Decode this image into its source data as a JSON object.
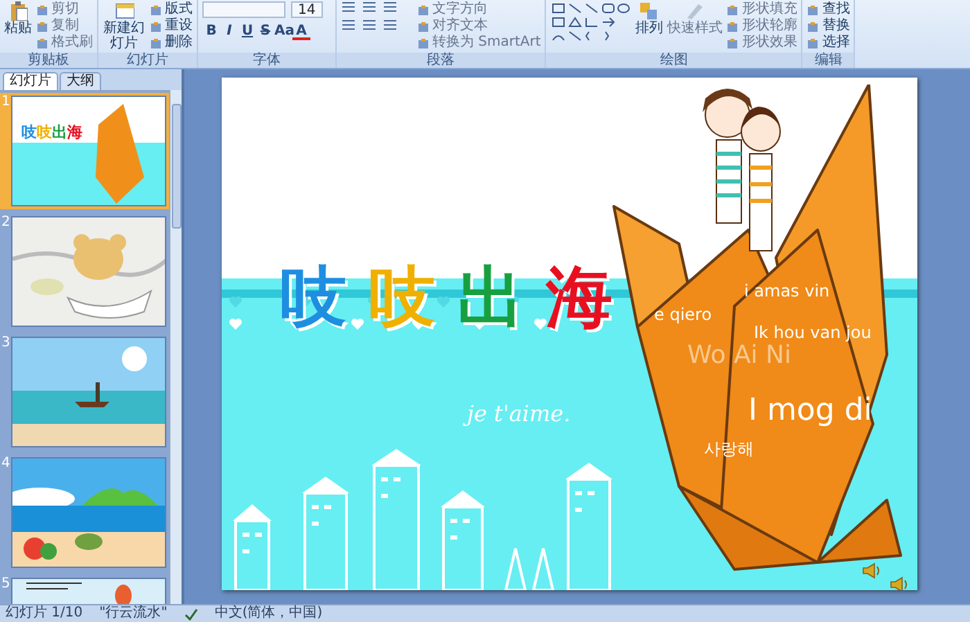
{
  "ribbon": {
    "groups": [
      {
        "label": "剪贴板",
        "kind": "clipboard",
        "large": [
          {
            "label": "粘贴",
            "disabled": false
          }
        ],
        "small": [
          {
            "label": "剪切",
            "disabled": true
          },
          {
            "label": "复制",
            "disabled": true
          },
          {
            "label": "格式刷",
            "disabled": true
          }
        ]
      },
      {
        "label": "幻灯片",
        "kind": "slides",
        "large": [
          {
            "label": "新建幻灯片",
            "disabled": false
          }
        ],
        "small": [
          {
            "label": "版式",
            "disabled": false
          },
          {
            "label": "重设",
            "disabled": false
          },
          {
            "label": "删除",
            "disabled": false
          }
        ]
      },
      {
        "label": "字体",
        "kind": "font",
        "font_size": "14",
        "format": [
          "B",
          "I",
          "U",
          "S",
          "Aa",
          "A"
        ]
      },
      {
        "label": "段落",
        "kind": "paragraph",
        "small": [
          {
            "label": "文字方向",
            "disabled": true
          },
          {
            "label": "对齐文本",
            "disabled": true
          },
          {
            "label": "转换为 SmartArt",
            "disabled": true
          }
        ]
      },
      {
        "label": "绘图",
        "kind": "drawing",
        "large": [
          {
            "label": "排列",
            "disabled": false
          },
          {
            "label": "快速样式",
            "disabled": true
          }
        ],
        "small": [
          {
            "label": "形状填充",
            "disabled": true
          },
          {
            "label": "形状轮廓",
            "disabled": true
          },
          {
            "label": "形状效果",
            "disabled": true
          }
        ]
      },
      {
        "label": "编辑",
        "kind": "editing",
        "small": [
          {
            "label": "查找",
            "disabled": false
          },
          {
            "label": "替换",
            "disabled": false
          },
          {
            "label": "选择",
            "disabled": false
          }
        ]
      }
    ]
  },
  "panel": {
    "tabs": [
      {
        "label": "幻灯片",
        "selected": true
      },
      {
        "label": "大纲",
        "selected": false
      }
    ],
    "thumbnails": [
      {
        "number": "1",
        "kind": "title",
        "selected": true,
        "title_chars": [
          {
            "text": "吱",
            "color": "#1e8fe0"
          },
          {
            "text": "吱",
            "color": "#f0b000"
          },
          {
            "text": "出",
            "color": "#18a040"
          },
          {
            "text": "海",
            "color": "#e81020"
          }
        ]
      },
      {
        "number": "2",
        "kind": "sketch",
        "selected": false
      },
      {
        "number": "3",
        "kind": "beach",
        "selected": false
      },
      {
        "number": "4",
        "kind": "island",
        "selected": false
      },
      {
        "number": "5",
        "kind": "balloon",
        "selected": false
      }
    ]
  },
  "slide": {
    "title_chars": [
      {
        "text": "吱",
        "color": "#1e8fe0"
      },
      {
        "text": "吱",
        "color": "#f0b000"
      },
      {
        "text": "出",
        "color": "#18a040"
      },
      {
        "text": "海",
        "color": "#e81020"
      }
    ],
    "script_text": "je t'aime.",
    "phrases": [
      {
        "text": "i amas vin",
        "kind": "small"
      },
      {
        "text": "e qiero",
        "kind": "small"
      },
      {
        "text": "Ik hou van jou",
        "kind": "small"
      },
      {
        "text": "Wo Ai Ni",
        "kind": "faded"
      },
      {
        "text": "I mog di",
        "kind": "large"
      },
      {
        "text": "사랑해",
        "kind": "small"
      }
    ]
  },
  "status_bar": {
    "slide_position": "幻灯片 1/10",
    "theme": "\"行云流水\"",
    "language": "中文(简体，中国)"
  }
}
